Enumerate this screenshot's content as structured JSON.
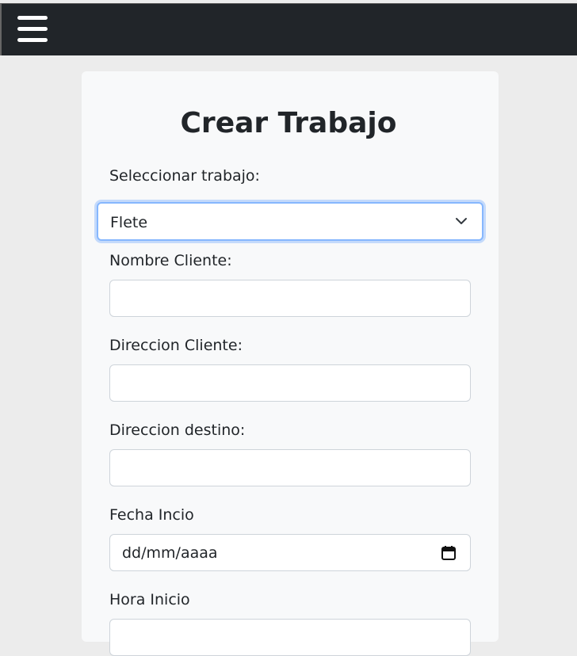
{
  "navbar": {
    "menu_icon": "hamburger-menu-icon"
  },
  "form": {
    "title": "Crear Trabajo",
    "job_type": {
      "label": "Seleccionar trabajo:",
      "selected": "Flete",
      "icon": "chevron-down-icon"
    },
    "client_name": {
      "label": "Nombre Cliente:",
      "value": ""
    },
    "client_address": {
      "label": "Direccion Cliente:",
      "value": ""
    },
    "destination_address": {
      "label": "Direccion destino:",
      "value": ""
    },
    "start_date": {
      "label": "Fecha Incio",
      "placeholder": "dd/mm/aaaa",
      "icon": "calendar-icon"
    },
    "start_time": {
      "label": "Hora Inicio"
    }
  },
  "colors": {
    "navbar_bg": "#212529",
    "page_bg": "#ececec",
    "card_bg": "#f8f9fa",
    "focus_border": "#86b7fe",
    "input_border": "#ced4da"
  }
}
